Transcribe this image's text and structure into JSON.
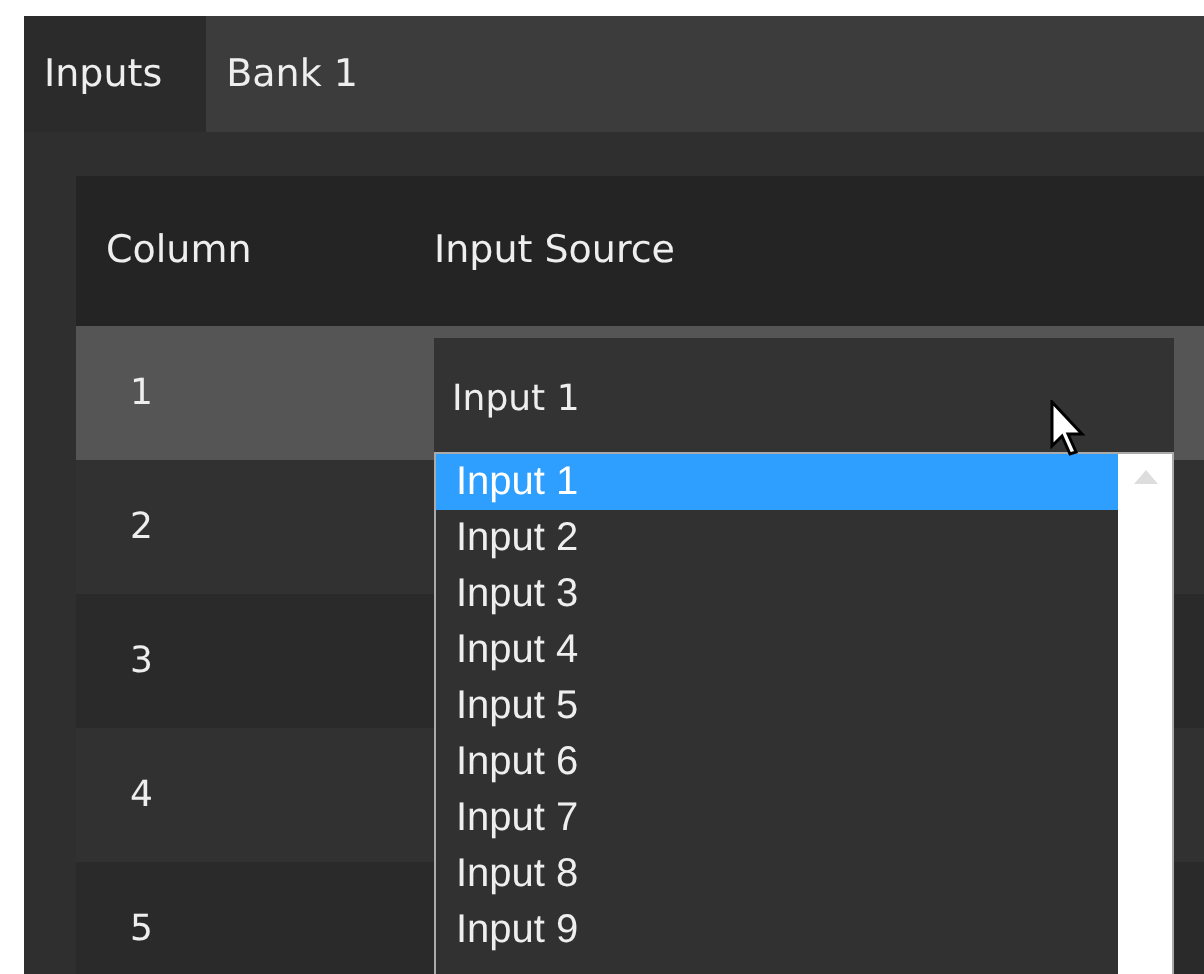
{
  "tabs": [
    {
      "label": "Inputs",
      "selected": true
    },
    {
      "label": "Bank 1",
      "selected": false
    }
  ],
  "table": {
    "columns": [
      "Column",
      "Input Source"
    ],
    "rows": [
      {
        "column": "1",
        "selected": true,
        "input_source": "Input 1"
      },
      {
        "column": "2",
        "selected": false
      },
      {
        "column": "3",
        "selected": false
      },
      {
        "column": "4",
        "selected": false
      },
      {
        "column": "5",
        "selected": false
      }
    ]
  },
  "dropdown": {
    "options": [
      {
        "label": "Input 1",
        "selected": true
      },
      {
        "label": "Input 2",
        "selected": false
      },
      {
        "label": "Input 3",
        "selected": false
      },
      {
        "label": "Input 4",
        "selected": false
      },
      {
        "label": "Input 5",
        "selected": false
      },
      {
        "label": "Input 6",
        "selected": false
      },
      {
        "label": "Input 7",
        "selected": false
      },
      {
        "label": "Input 8",
        "selected": false
      },
      {
        "label": "Input 9",
        "selected": false
      }
    ]
  }
}
